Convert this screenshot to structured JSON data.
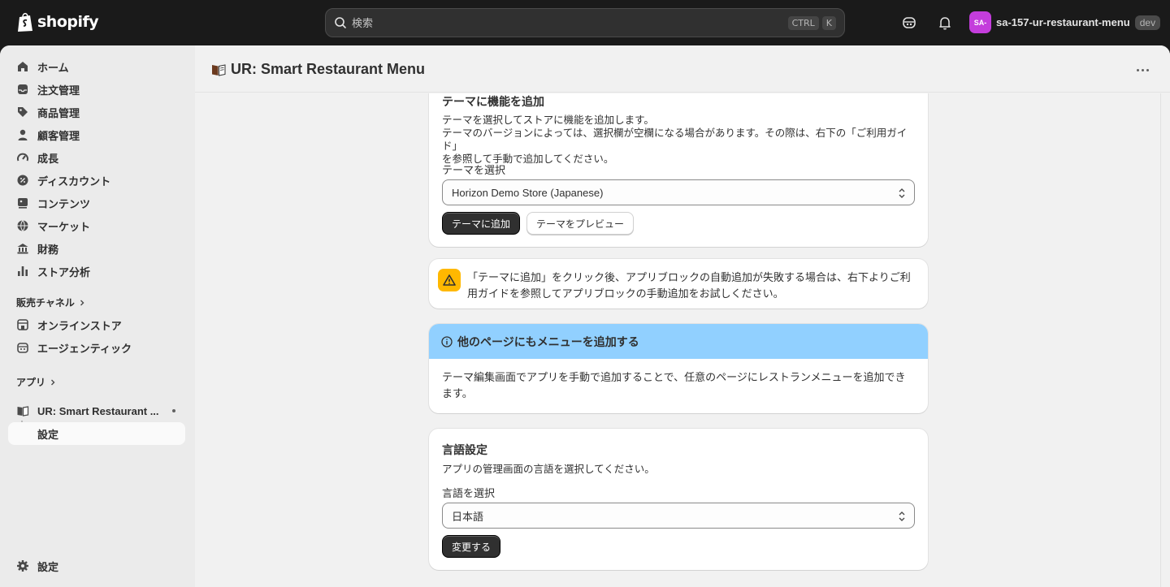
{
  "topbar": {
    "logo_text": "shopify",
    "search_placeholder": "検索",
    "shortcut_ctrl": "CTRL",
    "shortcut_k": "K",
    "store_avatar": "SA-",
    "store_name": "sa-157-ur-restaurant-menu",
    "store_badge": "dev"
  },
  "sidebar": {
    "items": [
      {
        "label": "ホーム",
        "icon": "home-icon"
      },
      {
        "label": "注文管理",
        "icon": "inbox-icon"
      },
      {
        "label": "商品管理",
        "icon": "tag-icon"
      },
      {
        "label": "顧客管理",
        "icon": "person-icon"
      },
      {
        "label": "成長",
        "icon": "gauge-icon"
      },
      {
        "label": "ディスカウント",
        "icon": "discount-icon"
      },
      {
        "label": "コンテンツ",
        "icon": "content-icon"
      },
      {
        "label": "マーケット",
        "icon": "globe-icon"
      },
      {
        "label": "財務",
        "icon": "bank-icon"
      },
      {
        "label": "ストア分析",
        "icon": "chart-icon"
      }
    ],
    "sales_channels_title": "販売チャネル",
    "channels": [
      {
        "label": "オンラインストア",
        "icon": "store-icon"
      },
      {
        "label": "エージェンティック",
        "icon": "robot-icon"
      }
    ],
    "apps_title": "アプリ",
    "app_item": "UR: Smart Restaurant ...",
    "app_sub_item": "設定",
    "settings": "設定"
  },
  "header": {
    "title": "UR: Smart Restaurant Menu"
  },
  "theme_card": {
    "title": "テーマに機能を追加",
    "desc_1": "テーマを選択してストアに機能を追加します。",
    "desc_2": "テーマのバージョンによっては、選択欄が空欄になる場合があります。その際は、右下の「ご利用ガイド」",
    "desc_3": "を参照して手動で追加してください。",
    "select_label": "テーマを選択",
    "select_value": "Horizon Demo Store (Japanese)",
    "add_button": "テーマに追加",
    "preview_button": "テーマをプレビュー"
  },
  "warning_card": {
    "line_1": "「テーマに追加」をクリック後、アプリブロックの自動追加が失敗する場合は、右下よりご利",
    "line_2": "用ガイドを参照してアプリブロックの手動追加をお試しください。"
  },
  "info_card": {
    "title": "他のページにもメニューを追加する",
    "line_1": "テーマ編集画面でアプリを手動で追加することで、任意のページにレストランメニューを追加でき",
    "line_2": "ます。"
  },
  "language_card": {
    "title": "言語設定",
    "desc": "アプリの管理画面の言語を選択してください。",
    "select_label": "言語を選択",
    "select_value": "日本語",
    "change_button": "変更する"
  },
  "colors": {
    "topbar": "#1a1a1a",
    "info_banner": "#91d0ff",
    "warning": "#ffb800",
    "avatar": "#c43ddc"
  }
}
